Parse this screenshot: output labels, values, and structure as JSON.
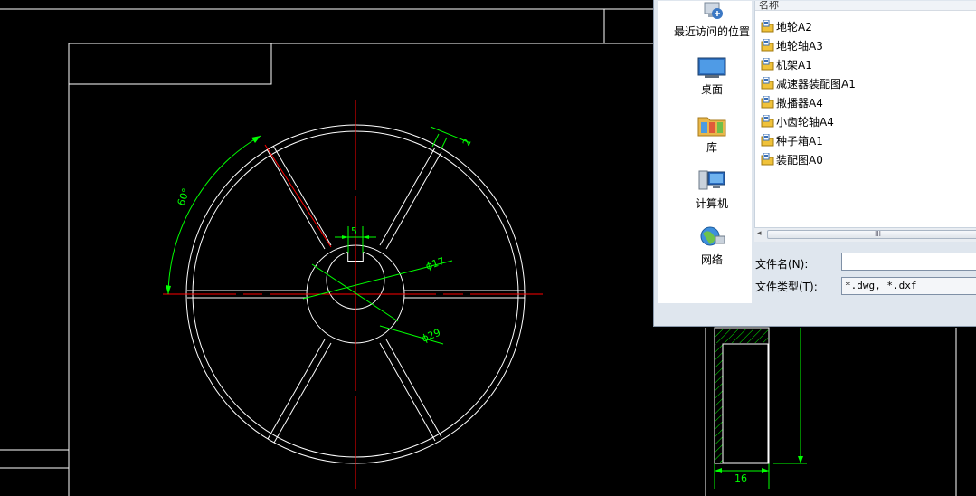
{
  "drawing": {
    "dim_width": "16",
    "dim_keyway": "5",
    "dim_bore": "ϕ17",
    "dim_hub": "ϕ29",
    "dim_spoke": "2",
    "dim_angle": "60°"
  },
  "dialog": {
    "list_header": "名称",
    "places": [
      {
        "label": "最近访问的位置",
        "icon": "recent-places-icon"
      },
      {
        "label": "桌面",
        "icon": "desktop-icon"
      },
      {
        "label": "库",
        "icon": "libraries-icon"
      },
      {
        "label": "计算机",
        "icon": "computer-icon"
      },
      {
        "label": "网络",
        "icon": "network-icon"
      }
    ],
    "files": [
      {
        "name": "地轮A2"
      },
      {
        "name": "地轮轴A3"
      },
      {
        "name": "机架A1"
      },
      {
        "name": "减速器装配图A1"
      },
      {
        "name": "撒播器A4"
      },
      {
        "name": "小齿轮轴A4"
      },
      {
        "name": "种子箱A1"
      },
      {
        "name": "装配图A0"
      }
    ],
    "scrollbar_grip": "III",
    "filename_label": "文件名(N):",
    "filename_value": "",
    "filetype_label": "文件类型(T):",
    "filetype_value": "*.dwg, *.dxf"
  },
  "colors": {
    "background": "#000000",
    "outline": "#ffffff",
    "centerline": "#ff0000",
    "dimension": "#00ff00"
  }
}
